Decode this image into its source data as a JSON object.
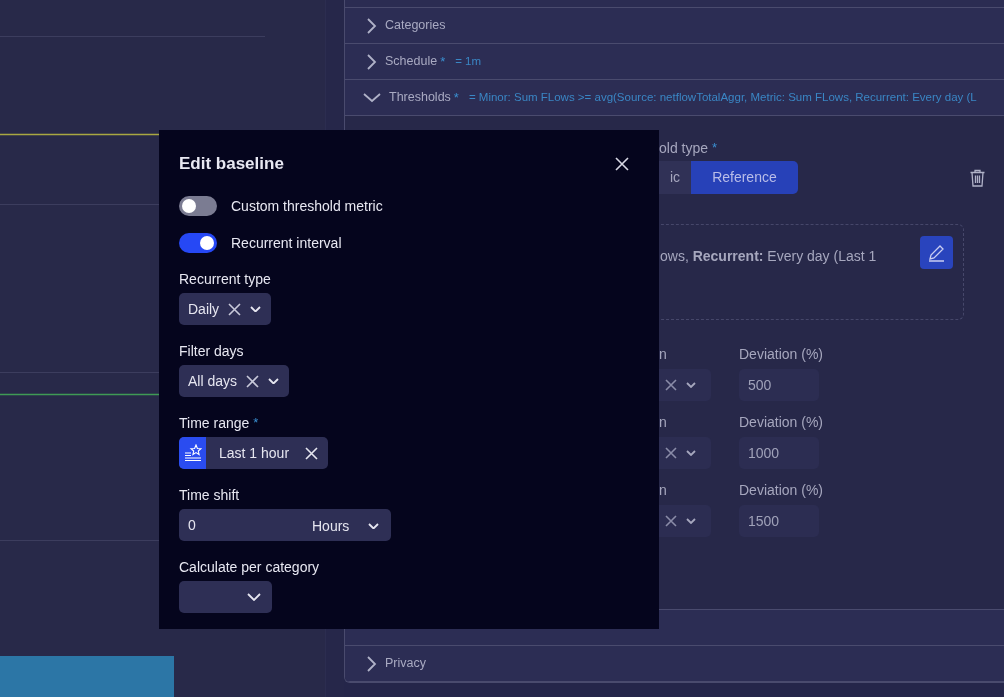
{
  "sections": [
    {
      "title": "Categories",
      "expanded": false
    },
    {
      "title": "Schedule",
      "required_mark": "*",
      "summary": "= 1m",
      "expanded": false
    },
    {
      "title": "Thresholds",
      "required_mark": "*",
      "summary": "= Minor: Sum FLows >= avg(Source: netflowTotalAggr, Metric: Sum FLows, Recurrent: Every day (L",
      "expanded": true
    },
    {
      "title": "Privacy",
      "expanded": false
    }
  ],
  "threshold": {
    "type_label": "old type",
    "required_mark": "*",
    "type_options": [
      {
        "label": "ic",
        "selected": false
      },
      {
        "label": "Reference",
        "selected": true
      }
    ],
    "baseline_summary": "ows, **Recurrent:** Every day (Last 1",
    "levels": [
      {
        "label": "n",
        "deviation_label": "Deviation (%)",
        "deviation": "500"
      },
      {
        "label": "n",
        "deviation_label": "Deviation (%)",
        "deviation": "1000"
      },
      {
        "label": "n",
        "deviation_label": "Deviation (%)",
        "deviation": "1500"
      }
    ]
  },
  "modal": {
    "title": "Edit baseline",
    "toggles": [
      {
        "label": "Custom threshold metric",
        "on": false
      },
      {
        "label": "Recurrent interval",
        "on": true
      }
    ],
    "fields": [
      {
        "kind": "select",
        "label": "Recurrent type",
        "value": "Daily",
        "clearable": true
      },
      {
        "kind": "select",
        "label": "Filter days",
        "value": "All days",
        "clearable": true
      },
      {
        "kind": "timerange",
        "label": "Time range",
        "required_mark": "*",
        "value": "Last 1 hour"
      },
      {
        "kind": "shift",
        "label": "Time shift",
        "value": "0",
        "unit": "Hours"
      },
      {
        "kind": "select",
        "label": "Calculate per category"
      }
    ]
  }
}
